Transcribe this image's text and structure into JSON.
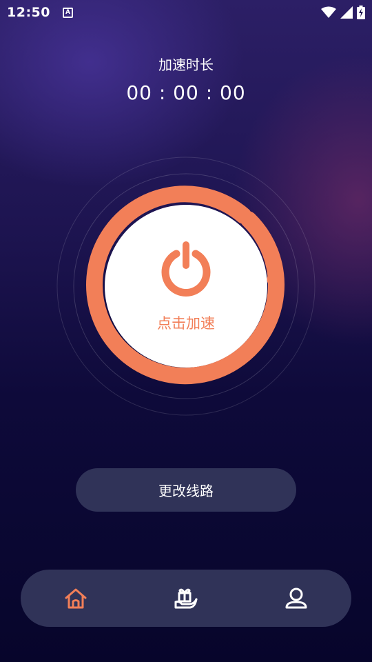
{
  "status_bar": {
    "time": "12:50",
    "notification_icon": "A",
    "icons": [
      "wifi-icon",
      "signal-icon",
      "battery-charging-icon"
    ]
  },
  "accelerator": {
    "title": "加速时长",
    "timer": "00 : 00 : 00",
    "power_label": "点击加速",
    "power_icon": "power-icon"
  },
  "route_button": {
    "label": "更改线路"
  },
  "bottom_nav": {
    "items": [
      {
        "name": "home",
        "icon": "home-icon",
        "active": true
      },
      {
        "name": "gift",
        "icon": "gift-hand-icon",
        "active": false
      },
      {
        "name": "profile",
        "icon": "user-icon",
        "active": false
      }
    ]
  },
  "colors": {
    "accent": "#f27f58",
    "panel": "#303358",
    "background_top": "#2c1f66",
    "background_bottom": "#07052b"
  }
}
